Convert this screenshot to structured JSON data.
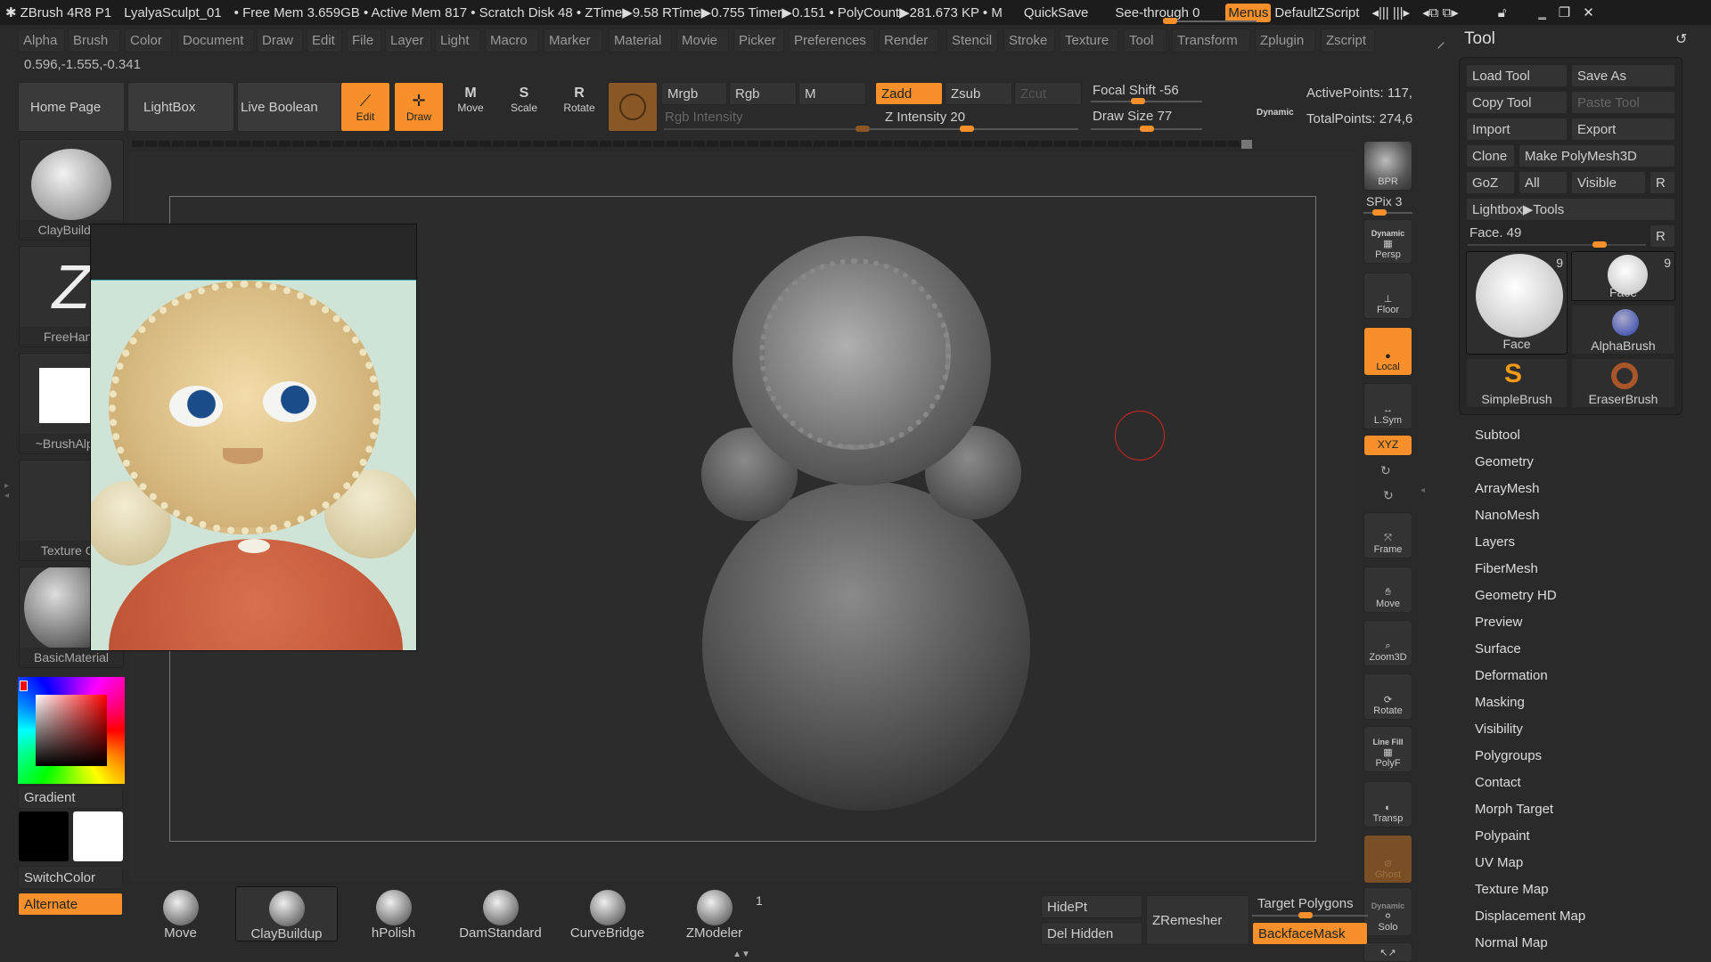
{
  "titlebar": {
    "app": "ZBrush 4R8 P1",
    "document": "LyalyaSculpt_01",
    "stats": "• Free Mem 3.659GB • Active Mem 817 • Scratch Disk 48 • ZTime▶9.58 RTime▶0.755 Timer▶0.151 • PolyCount▶281.673 KP • M",
    "quicksave": "QuickSave",
    "seethrough": "See-through  0",
    "seethrough_value": 0,
    "menus": "Menus",
    "script": "DefaultZScript"
  },
  "menubar": [
    "Alpha",
    "Brush",
    "Color",
    "Document",
    "Draw",
    "Edit",
    "File",
    "Layer",
    "Light",
    "Macro",
    "Marker",
    "Material",
    "Movie",
    "Picker",
    "Preferences",
    "Render",
    "Stencil",
    "Stroke",
    "Texture",
    "Tool",
    "Transform",
    "Zplugin",
    "Zscript"
  ],
  "coords": "0.596,-1.555,-0.341",
  "shelf": {
    "home": "Home Page",
    "lightbox": "LightBox",
    "liveboolean": "Live Boolean",
    "edit": "Edit",
    "draw": "Draw",
    "move": "Move",
    "scale": "Scale",
    "rotate": "Rotate",
    "mrgb": "Mrgb",
    "rgb": "Rgb",
    "m": "M",
    "rgb_intensity": "Rgb Intensity",
    "zadd": "Zadd",
    "zsub": "Zsub",
    "zcut": "Zcut",
    "z_intensity": "Z Intensity 20",
    "focal_shift": "Focal Shift -56",
    "draw_size": "Draw Size 77",
    "dynamic": "Dynamic",
    "active_points": "ActivePoints: 117,",
    "total_points": "TotalPoints: 274,6"
  },
  "left": {
    "thumbs": [
      "ClayBuildup",
      "FreeHand",
      "~BrushAlpha",
      "Texture Off",
      "BasicMaterial"
    ],
    "gradient": "Gradient",
    "switchcolor": "SwitchColor",
    "alternate": "Alternate",
    "main_color": "#ff0000"
  },
  "righttools": {
    "bpr": "BPR",
    "spix": "SPix 3",
    "dynamic": "Dynamic",
    "persp": "Persp",
    "floor": "Floor",
    "local": "Local",
    "lsym": "L.Sym",
    "xyz": "XYZ",
    "frame": "Frame",
    "move": "Move",
    "zoom3d": "Zoom3D",
    "rotate": "Rotate",
    "linefill": "Line Fill",
    "polyf": "PolyF",
    "transp": "Transp",
    "ghost": "Ghost",
    "dynamic2": "Dynamic",
    "solo": "Solo"
  },
  "tool": {
    "title": "Tool",
    "load": "Load Tool",
    "saveas": "Save As",
    "copy": "Copy Tool",
    "paste": "Paste Tool",
    "import": "Import",
    "export": "Export",
    "clone": "Clone",
    "polymesh": "Make PolyMesh3D",
    "goz": "GoZ",
    "all": "All",
    "visible": "Visible",
    "r": "R",
    "lightbox": "Lightbox▶Tools",
    "face": "Face. 49",
    "items": [
      {
        "name": "Face",
        "count": "9"
      },
      {
        "name": "Face",
        "count": "9"
      },
      {
        "name": "AlphaBrush"
      },
      {
        "name": "SimpleBrush"
      },
      {
        "name": "EraserBrush"
      }
    ],
    "menu": [
      "Subtool",
      "Geometry",
      "ArrayMesh",
      "NanoMesh",
      "Layers",
      "FiberMesh",
      "Geometry HD",
      "Preview",
      "Surface",
      "Deformation",
      "Masking",
      "Visibility",
      "Polygroups",
      "Contact",
      "Morph Target",
      "Polypaint",
      "UV Map",
      "Texture Map",
      "Displacement Map",
      "Normal Map"
    ]
  },
  "bottom": {
    "brushes": [
      "Move",
      "ClayBuildup",
      "hPolish",
      "DamStandard",
      "CurveBridge",
      "ZModeler"
    ],
    "zmodeler_count": "1",
    "hidept": "HidePt",
    "delhidden": "Del Hidden",
    "zremesher": "ZRemesher",
    "target": "Target Polygons",
    "backface": "BackfaceMask"
  },
  "colors": {
    "accent": "#f7902a",
    "bg": "#2a2a2a"
  }
}
